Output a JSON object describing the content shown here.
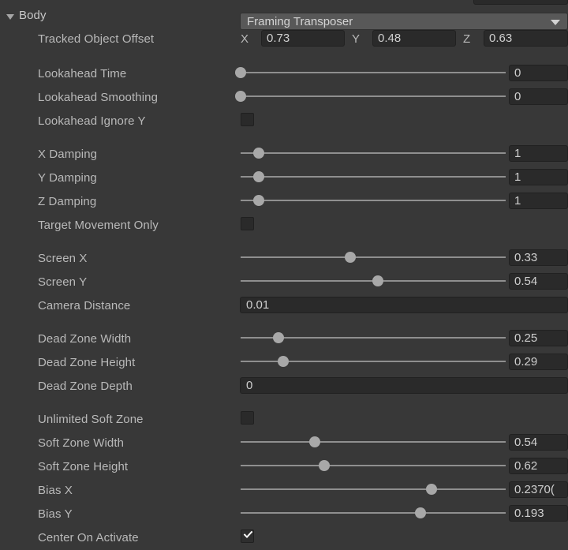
{
  "panel": {
    "background": "#383838",
    "accent_dropdown": "#585858"
  },
  "body_section": {
    "foldout_label": "Body",
    "expanded": true,
    "dropdown": {
      "selected": "Framing Transposer",
      "arrow_icon": "chevron-down-icon"
    }
  },
  "tracked_object_offset": {
    "label": "Tracked Object Offset",
    "x_axis_label": "X",
    "x_value": "0.73",
    "y_axis_label": "Y",
    "y_value": "0.48",
    "z_axis_label": "Z",
    "z_value": "0.63"
  },
  "rows": [
    {
      "label": "Lookahead Time",
      "type": "slider",
      "value": "0",
      "fill": 0.0
    },
    {
      "label": "Lookahead Smoothing",
      "type": "slider",
      "value": "0",
      "fill": 0.0
    },
    {
      "label": "Lookahead Ignore Y",
      "type": "checkbox",
      "checked": false
    },
    {
      "label": "X Damping",
      "type": "slider",
      "value": "1",
      "fill": 0.068
    },
    {
      "label": "Y Damping",
      "type": "slider",
      "value": "1",
      "fill": 0.068
    },
    {
      "label": "Z Damping",
      "type": "slider",
      "value": "1",
      "fill": 0.068
    },
    {
      "label": "Target Movement Only",
      "type": "checkbox",
      "checked": false
    },
    {
      "label": "Screen X",
      "type": "slider",
      "value": "0.33",
      "fill": 0.414
    },
    {
      "label": "Screen Y",
      "type": "slider",
      "value": "0.54",
      "fill": 0.518
    },
    {
      "label": "Camera Distance",
      "type": "wide",
      "value": "0.01"
    },
    {
      "label": "Dead Zone Width",
      "type": "slider",
      "value": "0.25",
      "fill": 0.143
    },
    {
      "label": "Dead Zone Height",
      "type": "slider",
      "value": "0.29",
      "fill": 0.161
    },
    {
      "label": "Dead Zone Depth",
      "type": "wide",
      "value": "0"
    },
    {
      "label": "Unlimited Soft Zone",
      "type": "checkbox",
      "checked": false
    },
    {
      "label": "Soft Zone Width",
      "type": "slider",
      "value": "0.54",
      "fill": 0.28
    },
    {
      "label": "Soft Zone Height",
      "type": "slider",
      "value": "0.62",
      "fill": 0.315
    },
    {
      "label": "Bias X",
      "type": "slider",
      "value": "0.2370(",
      "fill": 0.72
    },
    {
      "label": "Bias Y",
      "type": "slider",
      "value": "0.193",
      "fill": 0.679
    },
    {
      "label": "Center On Activate",
      "type": "checkbox",
      "checked": true
    }
  ]
}
